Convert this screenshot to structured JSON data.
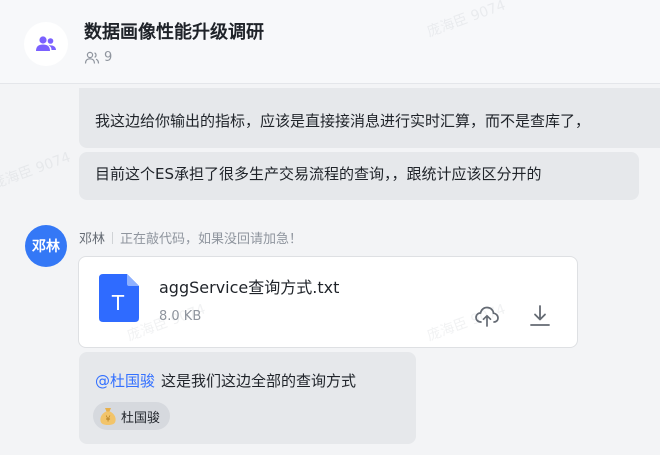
{
  "header": {
    "title": "数据画像性能升级调研",
    "member_count": "9",
    "group_icon": "group-icon"
  },
  "messages": {
    "msg1_text": "我这边给你输出的指标，应该是直接接消息进行实时汇算，而不是查库了，",
    "msg2_text": "目前这个ES承担了很多生产交易流程的查询，，跟统计应该区分开的"
  },
  "sender": {
    "avatar_text": "邓林",
    "name": "邓林",
    "status": "正在敲代码，如果没回请加急！",
    "avatar_color": "#3478f6"
  },
  "file": {
    "name": "aggService查询方式.txt",
    "size": "8.0 KB",
    "icon_letter": "T",
    "icon_color": "#2f6bff"
  },
  "msg3": {
    "mention": "@杜国骏",
    "text": "这是我们这边全部的查询方式",
    "reaction_user": "杜国骏",
    "reaction_icon": "money-bag-icon"
  },
  "watermark": "庞海臣 9074"
}
